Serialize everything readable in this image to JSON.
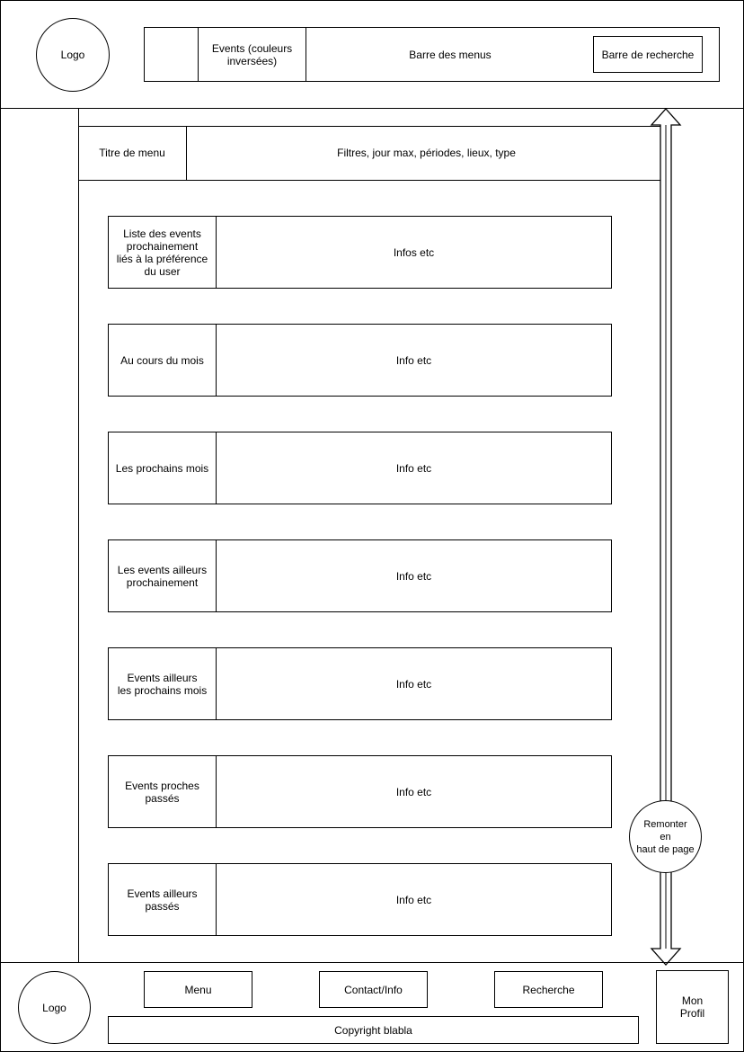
{
  "header": {
    "logo_label": "Logo",
    "menu_bar": {
      "blank_cell": "",
      "events_tab_label": "Events (couleurs\ninversées)",
      "menus_label": "Barre des menus",
      "search_label": "Barre de recherche"
    }
  },
  "menu_header": {
    "title": "Titre de menu",
    "filters": "Filtres, jour max, périodes, lieux, type"
  },
  "event_sections": [
    {
      "label": "Liste des events\nprochainement\nliés à la préférence\ndu user",
      "info": "Infos etc"
    },
    {
      "label": "Au cours du mois",
      "info": "Info etc"
    },
    {
      "label": "Les prochains mois",
      "info": "Info etc"
    },
    {
      "label": "Les events ailleurs\nprochainement",
      "info": "Info etc"
    },
    {
      "label": "Events ailleurs\nles prochains mois",
      "info": "Info etc"
    },
    {
      "label": "Events proches\npassés",
      "info": "Info etc"
    },
    {
      "label": "Events ailleurs\npassés",
      "info": "Info etc"
    }
  ],
  "scroll_to_top": {
    "label": "Remonter\nen\nhaut de page"
  },
  "footer": {
    "logo_label": "Logo",
    "menu_label": "Menu",
    "contact_label": "Contact/Info",
    "search_label": "Recherche",
    "profile_label": "Mon\nProfil",
    "copyright": "Copyright blabla"
  }
}
